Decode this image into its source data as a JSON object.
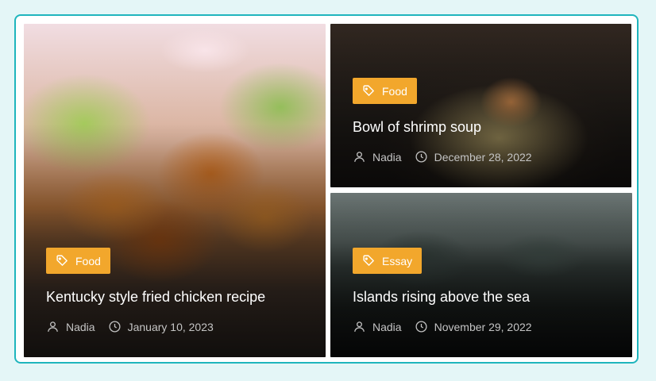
{
  "posts": [
    {
      "category": "Food",
      "title": "Kentucky style fried chicken recipe",
      "author": "Nadia",
      "date": "January 10, 2023",
      "icons": {
        "category": "tag-icon",
        "author": "user-icon",
        "date": "clock-icon"
      }
    },
    {
      "category": "Food",
      "title": "Bowl of shrimp soup",
      "author": "Nadia",
      "date": "December 28, 2022",
      "icons": {
        "category": "tag-icon",
        "author": "user-icon",
        "date": "clock-icon"
      }
    },
    {
      "category": "Essay",
      "title": "Islands rising above the sea",
      "author": "Nadia",
      "date": "November 29, 2022",
      "icons": {
        "category": "tag-icon",
        "author": "user-icon",
        "date": "clock-icon"
      }
    }
  ],
  "colors": {
    "accent": "#f2a72c",
    "frame_border": "#1fb5bd",
    "page_bg": "#e4f6f7",
    "meta_text": "#c4c4c4"
  }
}
